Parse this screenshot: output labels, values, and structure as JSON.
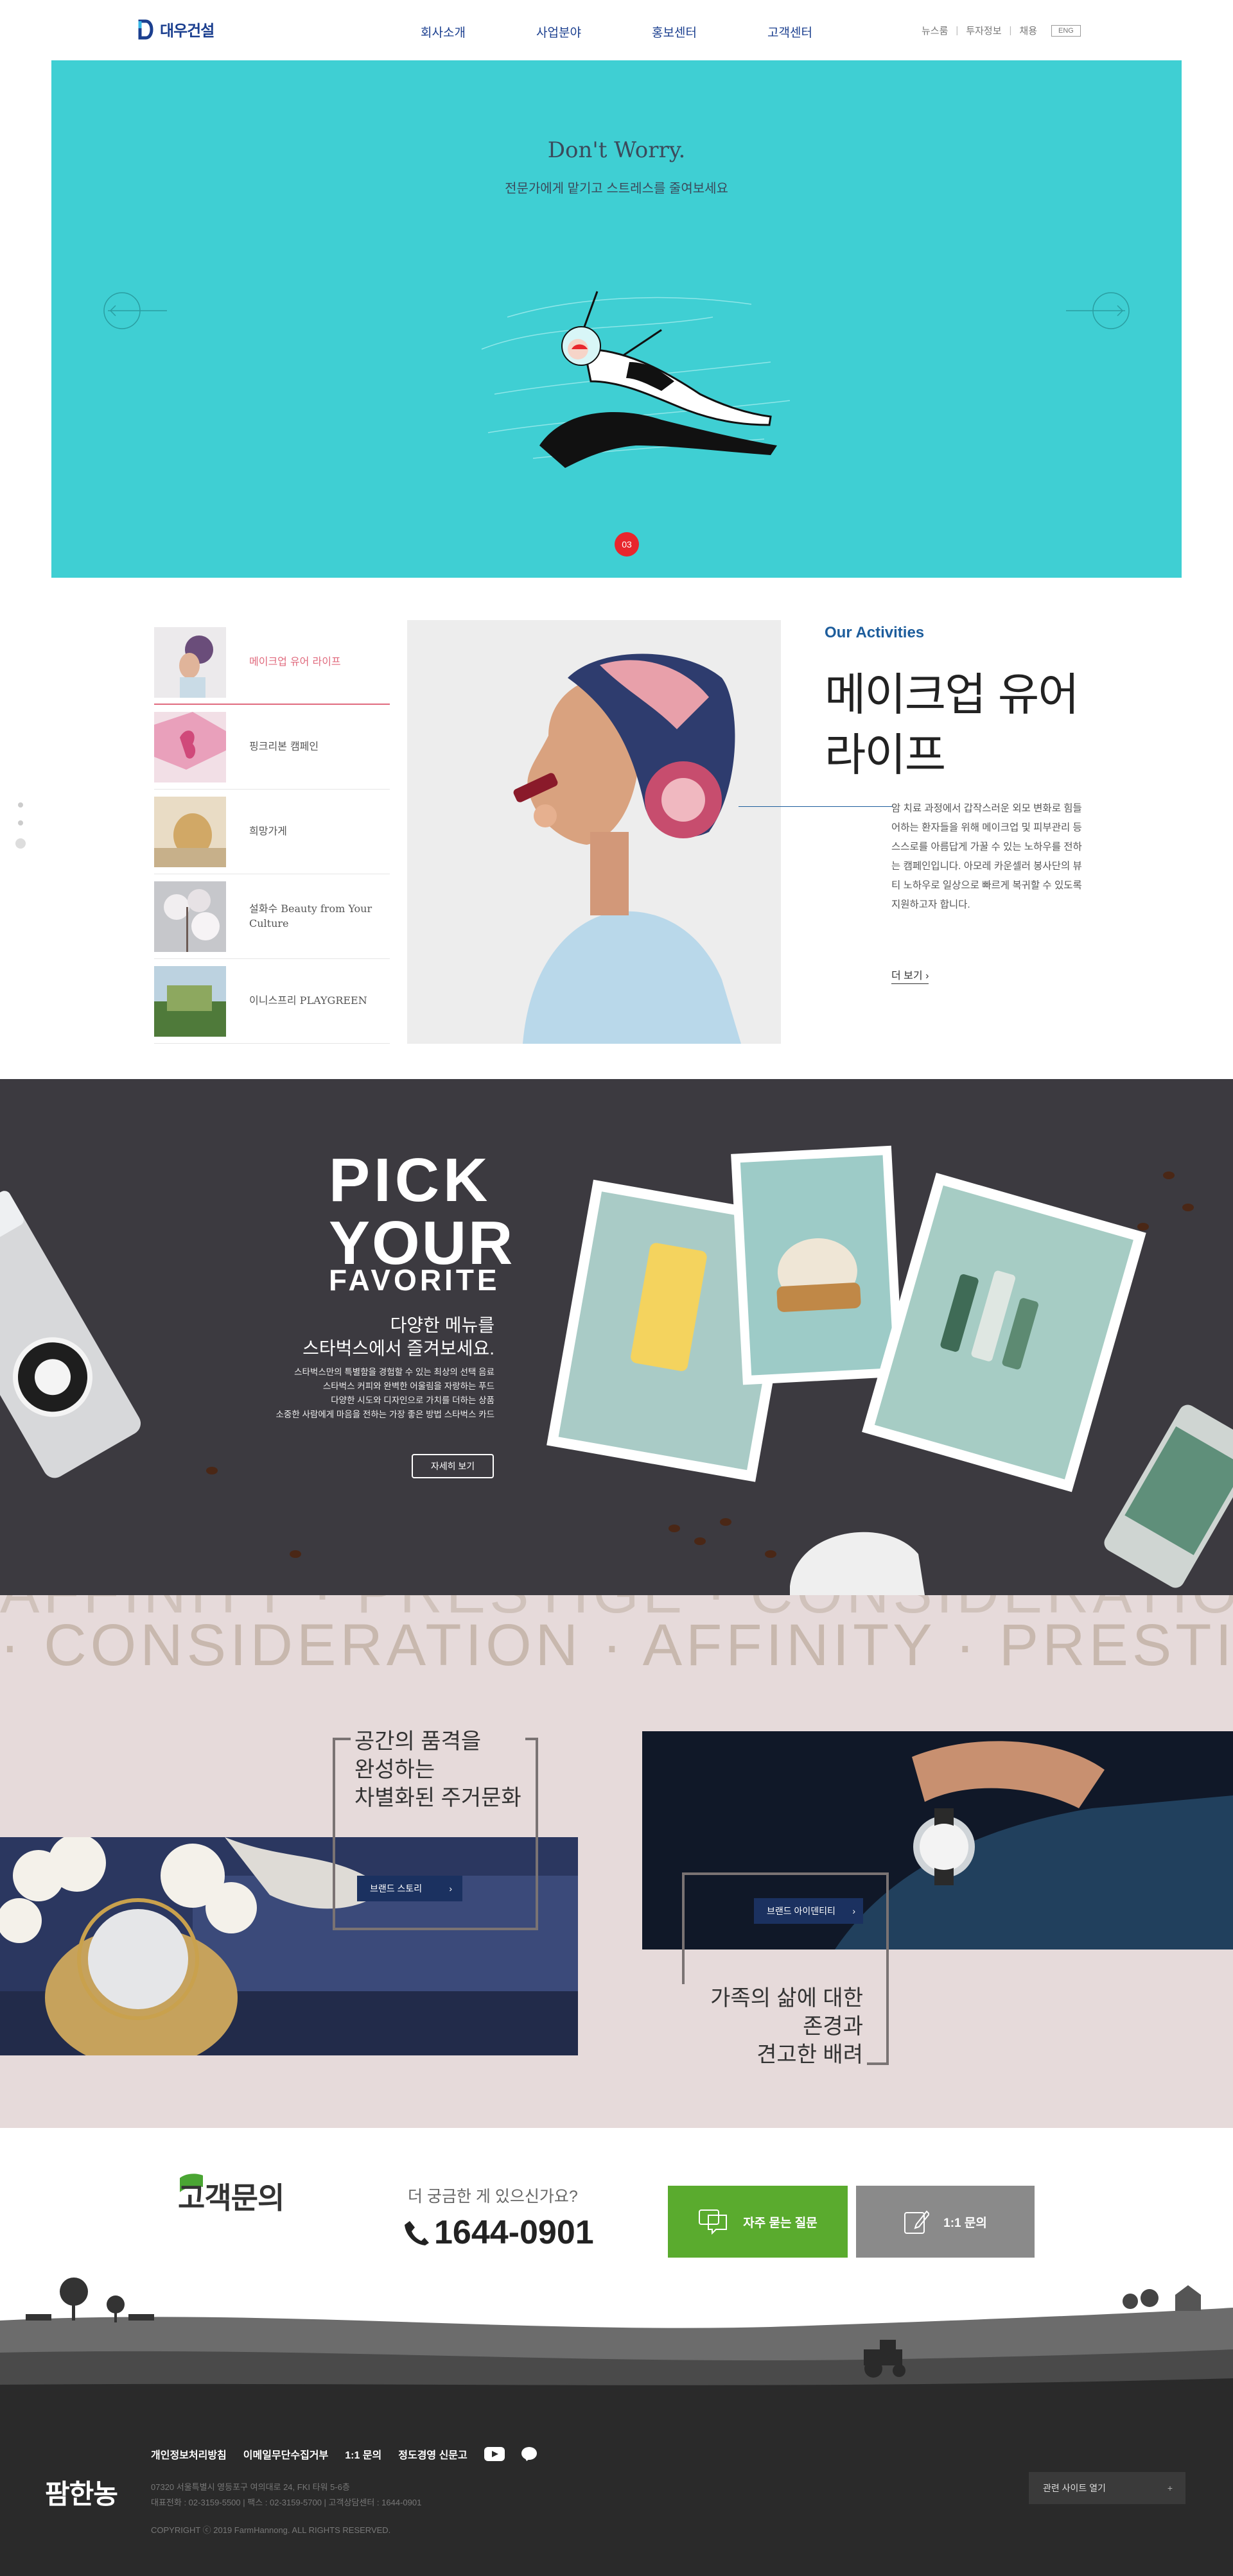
{
  "header": {
    "logo_text": "대우건설",
    "nav": [
      "회사소개",
      "사업분야",
      "홍보센터",
      "고객센터"
    ],
    "util": [
      "뉴스룸",
      "투자정보",
      "채용"
    ],
    "lang": "ENG"
  },
  "hero": {
    "title": "Don't Worry.",
    "subtitle": "전문가에게 맡기고 스트레스를 줄여보세요",
    "page_number": "03"
  },
  "activities": {
    "list": [
      {
        "label": "메이크업 유어 라이프",
        "active": true
      },
      {
        "label": "핑크리본 캠페인",
        "active": false
      },
      {
        "label": "희망가게",
        "active": false
      },
      {
        "label": "설화수 Beauty from Your Culture",
        "active": false
      },
      {
        "label": "이니스프리 PLAYGREEN",
        "active": false
      }
    ],
    "eyebrow": "Our Activities",
    "title": "메이크업 유어 라이프",
    "description": "암 치료 과정에서 갑작스러운 외모 변화로 힘들어하는 환자들을 위해 메이크업 및 피부관리 등 스스로를 아름답게 가꿀 수 있는 노하우를 전하는 캠페인입니다. 아모레 카운셀러 봉사단의 뷰티 노하우로 일상으로 빠르게 복귀할 수 있도록 지원하고자 합니다.",
    "more": "더 보기"
  },
  "starbucks": {
    "pick": "PICK",
    "your": "YOUR",
    "favorite": "FAVORITE",
    "heading_line1": "다양한 메뉴를",
    "heading_line2": "스타벅스에서 즐겨보세요.",
    "body": [
      "스타벅스만의 특별함을 경험할 수 있는 최상의 선택 음료",
      "스타벅스 커피와 완벽한 어울림을 자랑하는 푸드",
      "다양한 시도와 디자인으로 가치를 더하는 상품",
      "소중한 사람에게 마음을 전하는 가장 좋은 방법 스타벅스 카드"
    ],
    "button": "자세히 보기"
  },
  "brand": {
    "marquee_top": "AFFINITY · PRESTIGE · CONSIDERATION · AFFINITY · PRESTIGE",
    "marquee_mid": "· CONSIDERATION · AFFINITY · PRESTIGE · CONSIDERATION",
    "left_text": [
      "공간의 품격을",
      "완성하는",
      "차별화된 주거문화"
    ],
    "left_button": "브랜드 스토리",
    "right_text": [
      "가족의 삶에 대한",
      "존경과",
      "견고한 배려"
    ],
    "right_button": "브랜드 아이덴티티"
  },
  "customer": {
    "title": "고객문의",
    "question": "더 궁금한 게 있으신가요?",
    "phone": "1644-0901",
    "faq_button": "자주 묻는 질문",
    "qna_button": "1:1 문의"
  },
  "footer": {
    "logo": "팜한농",
    "links": [
      "개인정보처리방침",
      "이메일무단수집거부",
      "1:1 문의",
      "정도경영 신문고"
    ],
    "address": "07320 서울특별시 영등포구 여의대로 24, FKI 타워 5-6층",
    "contact": "대표전화 : 02-3159-5500  |  팩스 : 02-3159-5700  |  고객상담센터 : 1644-0901",
    "copyright": "COPYRIGHT ⓒ 2019 FarmHannong. ALL RIGHTS RESERVED.",
    "family_site": "관련 사이트 열기"
  },
  "colors": {
    "brand_blue": "#1b3f8f",
    "hero_bg": "#3fcfd3",
    "accent_pink": "#e06a7d",
    "starbucks_bg": "#3c3a40",
    "brand_bg": "#e6dada",
    "green": "#5aab2e",
    "footer_bg": "#2a2a2a"
  }
}
